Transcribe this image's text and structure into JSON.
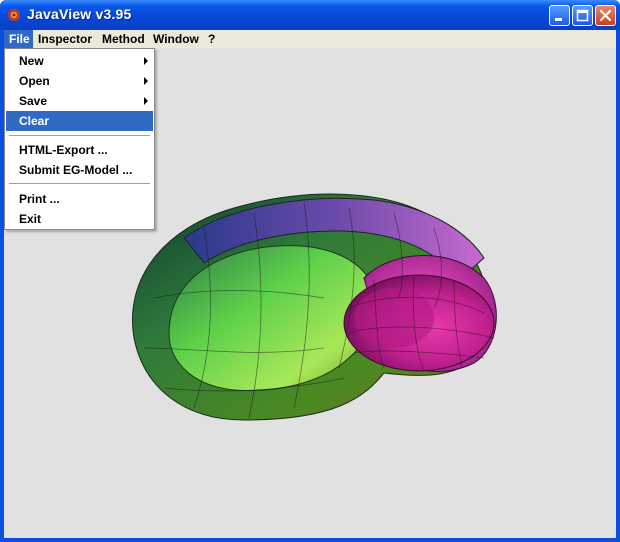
{
  "window": {
    "title": "JavaView v3.95"
  },
  "menubar": {
    "items": [
      {
        "label": "File"
      },
      {
        "label": "Inspector"
      },
      {
        "label": "Method"
      },
      {
        "label": "Window"
      },
      {
        "label": "?"
      }
    ]
  },
  "file_menu": {
    "items": [
      {
        "label": "New",
        "submenu": true
      },
      {
        "label": "Open",
        "submenu": true
      },
      {
        "label": "Save",
        "submenu": true
      },
      {
        "label": "Clear",
        "selected": true
      },
      {
        "label": "HTML-Export ..."
      },
      {
        "label": "Submit EG-Model ..."
      },
      {
        "label": "Print ..."
      },
      {
        "label": "Exit"
      }
    ]
  },
  "colors": {
    "title_blue": "#0A58E8",
    "menu_highlight": "#316AC5",
    "canvas_bg": "#E1E1E1",
    "shell_green": "#3FA32E",
    "shell_magenta": "#C0208F"
  },
  "icons": [
    "app-icon",
    "minimize-icon",
    "maximize-icon",
    "close-icon",
    "submenu-arrow-icon"
  ]
}
